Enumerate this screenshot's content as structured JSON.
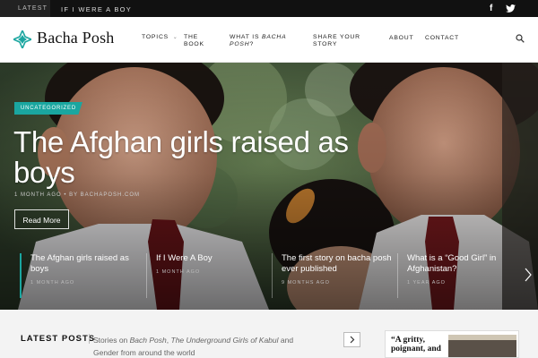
{
  "topbar": {
    "latest_label": "Latest",
    "ticker_text": "If I Were a Boy",
    "social": [
      {
        "icon": "facebook-icon",
        "glyph": "f"
      },
      {
        "icon": "twitter-icon",
        "glyph": "🐦"
      }
    ]
  },
  "header": {
    "logo_text": "Bacha Posh",
    "nav": {
      "topics": "Topics",
      "the_book_line1": "The",
      "the_book_line2": "Book",
      "what_is_line1_a": "What is ",
      "what_is_line1_b": "Bacha",
      "what_is_line2_a": "Posh",
      "what_is_line2_b": "?",
      "share_line1": "Share Your",
      "share_line2": "Story",
      "about": "About",
      "contact": "Contact"
    }
  },
  "hero": {
    "category": "Uncategorized",
    "title": "The Afghan girls raised as boys",
    "meta": "1 month ago  •  by bachaposh.com",
    "read_more": "Read More"
  },
  "slides": [
    {
      "title": "The Afghan girls raised as boys",
      "date": "1 month ago"
    },
    {
      "title": "If I Were A Boy",
      "date": "1 month ago"
    },
    {
      "title": "The first story on bacha posh ever published",
      "date": "9 months ago"
    },
    {
      "title": "What is a “Good Girl” in Afghanistan?",
      "date": "1 year ago"
    }
  ],
  "latest_posts": {
    "heading": "LATEST POSTS",
    "desc_a": "Stories on ",
    "desc_b": "Bach Posh",
    "desc_c": ", ",
    "desc_d": "The Underground Girls of Kabul",
    "desc_e": " and Gender from around the world"
  },
  "book_promo": {
    "quote_line1": "“A gritty,",
    "quote_line2": "poignant, and"
  },
  "colors": {
    "accent": "#1aa6a0",
    "topbar": "#111111"
  }
}
